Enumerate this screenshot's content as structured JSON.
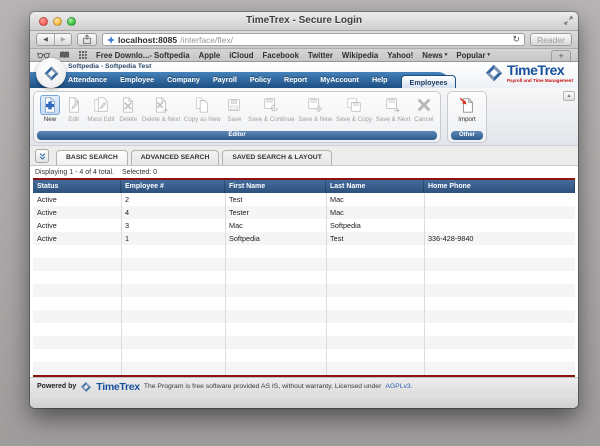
{
  "colors": {
    "nav_blue": "#1d4f82",
    "table_header_blue": "#2e517c",
    "accent_red_line": "#8e1414",
    "brand_blue": "#17519b",
    "brand_red": "#c40d0d",
    "link_blue": "#2c5fae"
  },
  "glyphs": {
    "back": "◀",
    "forward": "▶",
    "reload": "↻",
    "new_tab": "+",
    "menu_caret": "▾",
    "scroll_up": "▲"
  },
  "browser": {
    "window_title": "TimeTrex - Secure Login",
    "url": {
      "host": "localhost:8085",
      "path": "/interface/flex/"
    },
    "reader_label": "Reader",
    "bookmarks": [
      {
        "label": "Free Downlo...- Softpedia",
        "menu": false
      },
      {
        "label": "Apple",
        "menu": false
      },
      {
        "label": "iCloud",
        "menu": false
      },
      {
        "label": "Facebook",
        "menu": false
      },
      {
        "label": "Twitter",
        "menu": false
      },
      {
        "label": "Wikipedia",
        "menu": false
      },
      {
        "label": "Yahoo!",
        "menu": false
      },
      {
        "label": "News",
        "menu": true
      },
      {
        "label": "Popular",
        "menu": true
      }
    ]
  },
  "app": {
    "account_label": "Softpedia - Softpedia Test",
    "brand": {
      "name": "TimeTrex",
      "tagline": "Payroll and Time Management"
    },
    "nav_tabs": [
      "Attendance",
      "Employee",
      "Company",
      "Payroll",
      "Policy",
      "Report",
      "MyAccount",
      "Help"
    ],
    "active_nav_tab": "Employees",
    "toolbar": {
      "editor_label": "Editor",
      "other_label": "Other",
      "buttons": [
        {
          "label": "New",
          "enabled": true
        },
        {
          "label": "Edit",
          "enabled": false
        },
        {
          "label": "Mass Edit",
          "enabled": false
        },
        {
          "label": "Delete",
          "enabled": false
        },
        {
          "label": "Delete & Next",
          "enabled": false
        },
        {
          "label": "Copy as New",
          "enabled": false
        },
        {
          "label": "Save",
          "enabled": false
        },
        {
          "label": "Save & Continue",
          "enabled": false
        },
        {
          "label": "Save & New",
          "enabled": false
        },
        {
          "label": "Save & Copy",
          "enabled": false
        },
        {
          "label": "Save & Next",
          "enabled": false
        },
        {
          "label": "Cancel",
          "enabled": false
        }
      ],
      "import_button": {
        "label": "Import",
        "enabled": true
      }
    },
    "search": {
      "tabs": [
        "BASIC SEARCH",
        "ADVANCED SEARCH",
        "SAVED SEARCH & LAYOUT"
      ]
    },
    "status": {
      "displaying": "Displaying 1 - 4 of 4 total.",
      "selected": "Selected: 0"
    },
    "table": {
      "columns": [
        "Status",
        "Employee #",
        "First Name",
        "Last Name",
        "Home Phone"
      ],
      "rows": [
        [
          "Active",
          "2",
          "Test",
          "Mac",
          ""
        ],
        [
          "Active",
          "4",
          "Tester",
          "Mac",
          ""
        ],
        [
          "Active",
          "3",
          "Mac",
          "Softpedia",
          ""
        ],
        [
          "Active",
          "1",
          "Softpedia",
          "Test",
          "336-428-9840"
        ]
      ]
    },
    "footer": {
      "powered_by": "Powered by",
      "brand": "TimeTrex",
      "license_text": "The Program is free software provided AS IS, without warranty. Licensed under",
      "license_link": "AGPLv3."
    }
  }
}
